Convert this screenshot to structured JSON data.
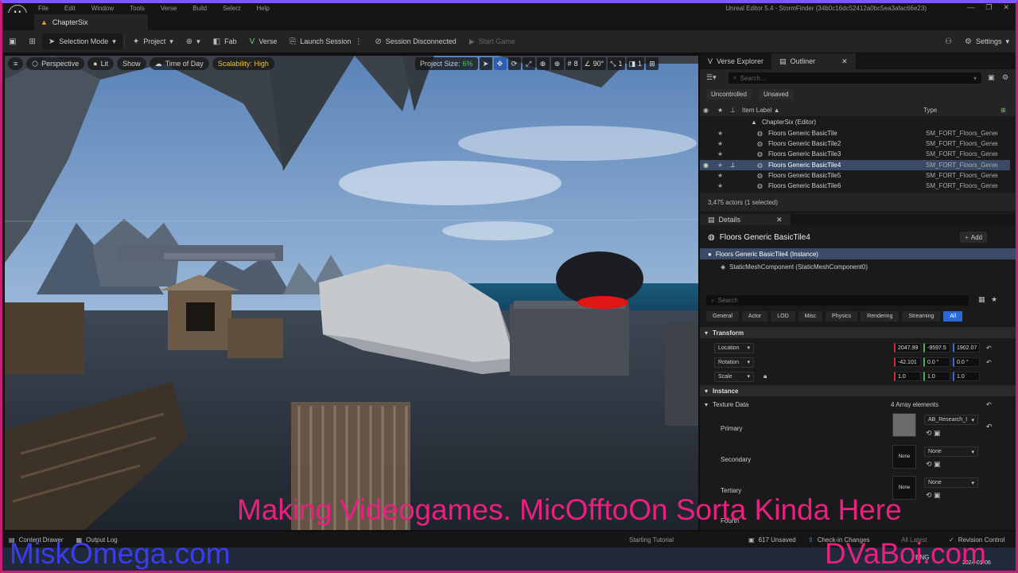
{
  "menu": {
    "items": [
      "File",
      "Edit",
      "Window",
      "Tools",
      "Verse",
      "Build",
      "Select",
      "Help"
    ],
    "window_title": "Unreal Editor 5.4 - StormFinder (34b0c16dc52412a0bc5ea3afac66e23)"
  },
  "level_tab": {
    "label": "ChapterSix"
  },
  "toolbar": {
    "selection_mode": "Selection Mode",
    "project": "Project",
    "fab": "Fab",
    "verse": "Verse",
    "launch_session": "Launch Session",
    "session_status": "Session Disconnected",
    "start_game": "Start Game",
    "settings": "Settings"
  },
  "viewport": {
    "perspective": "Perspective",
    "lit": "Lit",
    "show": "Show",
    "time_of_day": "Time of Day",
    "scalability": "Scalability: High",
    "project_size_label": "Project Size:",
    "project_size_value": "6%",
    "grid_value": "8",
    "angle_value": "90°",
    "scale_value": "1",
    "camera_value": "1"
  },
  "outliner": {
    "tab_verse": "Verse Explorer",
    "tab_outliner": "Outliner",
    "search_placeholder": "Search...",
    "chip_uncontrolled": "Uncontrolled",
    "chip_unsaved": "Unsaved",
    "col_item_label": "Item Label ▲",
    "col_type": "Type",
    "root": "ChapterSix (Editor)",
    "rows": [
      {
        "name": "Floors Generic BasicTile",
        "type": "SM_FORT_Floors_Generic"
      },
      {
        "name": "Floors Generic BasicTile2",
        "type": "SM_FORT_Floors_Generic"
      },
      {
        "name": "Floors Generic BasicTile3",
        "type": "SM_FORT_Floors_Generic"
      },
      {
        "name": "Floors Generic BasicTile4",
        "type": "SM_FORT_Floors_Generic"
      },
      {
        "name": "Floors Generic BasicTile5",
        "type": "SM_FORT_Floors_Generic"
      },
      {
        "name": "Floors Generic BasicTile6",
        "type": "SM_FORT_Floors_Generic"
      }
    ],
    "count": "3,475 actors (1 selected)"
  },
  "details": {
    "tab": "Details",
    "object_name": "Floors Generic BasicTile4",
    "add": "Add",
    "instance": "Floors Generic BasicTile4 (Instance)",
    "component": "StaticMeshComponent (StaticMeshComponent0)",
    "search_placeholder": "Search",
    "filters": [
      "General",
      "Actor",
      "LOD",
      "Misc",
      "Physics",
      "Rendering",
      "Streaming",
      "All"
    ],
    "transform": "Transform",
    "location": "Location",
    "rotation": "Rotation",
    "scale": "Scale",
    "loc": [
      "2047.99",
      "-9597.5",
      "1902.07"
    ],
    "rot": [
      "-42.101",
      "0.0 °",
      "0.0 °"
    ],
    "scl": [
      "1.0",
      "1.0",
      "1.0"
    ],
    "instance_cat": "Instance",
    "texture_data": "Texture Data",
    "array_elements": "4 Array elements",
    "primary": "Primary",
    "primary_value": "AB_Research_I",
    "secondary": "Secondary",
    "tertiary": "Tertiary",
    "fourth": "Fourth",
    "none": "None"
  },
  "status": {
    "content_drawer": "Content Drawer",
    "output_log": "Output Log",
    "unsaved": "617 Unsaved",
    "check_in": "Check-in Changes",
    "revision_control": "Revision Control",
    "viewport_tag": "Starting Tutorial",
    "latest": "All Latest"
  },
  "taskbar": {
    "lang": "ENG",
    "date": "2024-01-06"
  },
  "overlay": {
    "title": "Making Videogames. MicOfftoOn Sorta Kinda Here",
    "left": "MiskOmega.com",
    "right": "DVaBoi.com"
  }
}
